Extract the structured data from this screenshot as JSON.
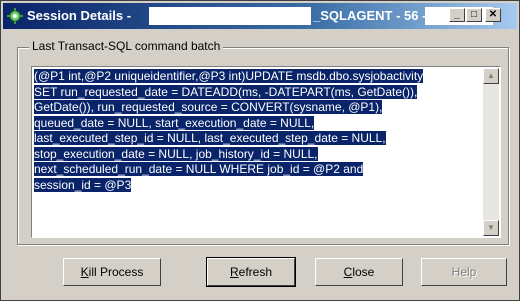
{
  "window": {
    "title": "Session Details -",
    "title_part2": "_SQLAGENT - 56 -"
  },
  "group": {
    "label": "Last Transact-SQL command batch"
  },
  "command_lines": [
    "(@P1 int,@P2 uniqueidentifier,@P3 int)UPDATE msdb.dbo.sysjobactivity",
    "SET run_requested_date = DATEADD(ms, -DATEPART(ms, GetDate()),",
    "GetDate()), run_requested_source = CONVERT(sysname, @P1),",
    "queued_date = NULL, start_execution_date = NULL,",
    "last_executed_step_id = NULL, last_executed_step_date = NULL,",
    "stop_execution_date = NULL, job_history_id = NULL,",
    "next_scheduled_run_date = NULL WHERE job_id = @P2 and",
    "session_id = @P3"
  ],
  "buttons": {
    "kill": {
      "mnemonic": "K",
      "rest": "ill Process"
    },
    "refresh": {
      "mnemonic": "R",
      "rest": "efresh"
    },
    "close": {
      "mnemonic": "C",
      "rest": "lose"
    },
    "help": {
      "label": "Help"
    }
  },
  "icons": {
    "app": "gear-icon",
    "minimize": "minimize-icon",
    "maximize": "maximize-icon",
    "close": "close-icon",
    "scroll_up": "arrow-up-icon",
    "scroll_down": "arrow-down-icon"
  },
  "colors": {
    "title_start": "#0a246a",
    "title_end": "#a6caf0",
    "selection": "#0a246a",
    "face": "#d4d0c8"
  }
}
